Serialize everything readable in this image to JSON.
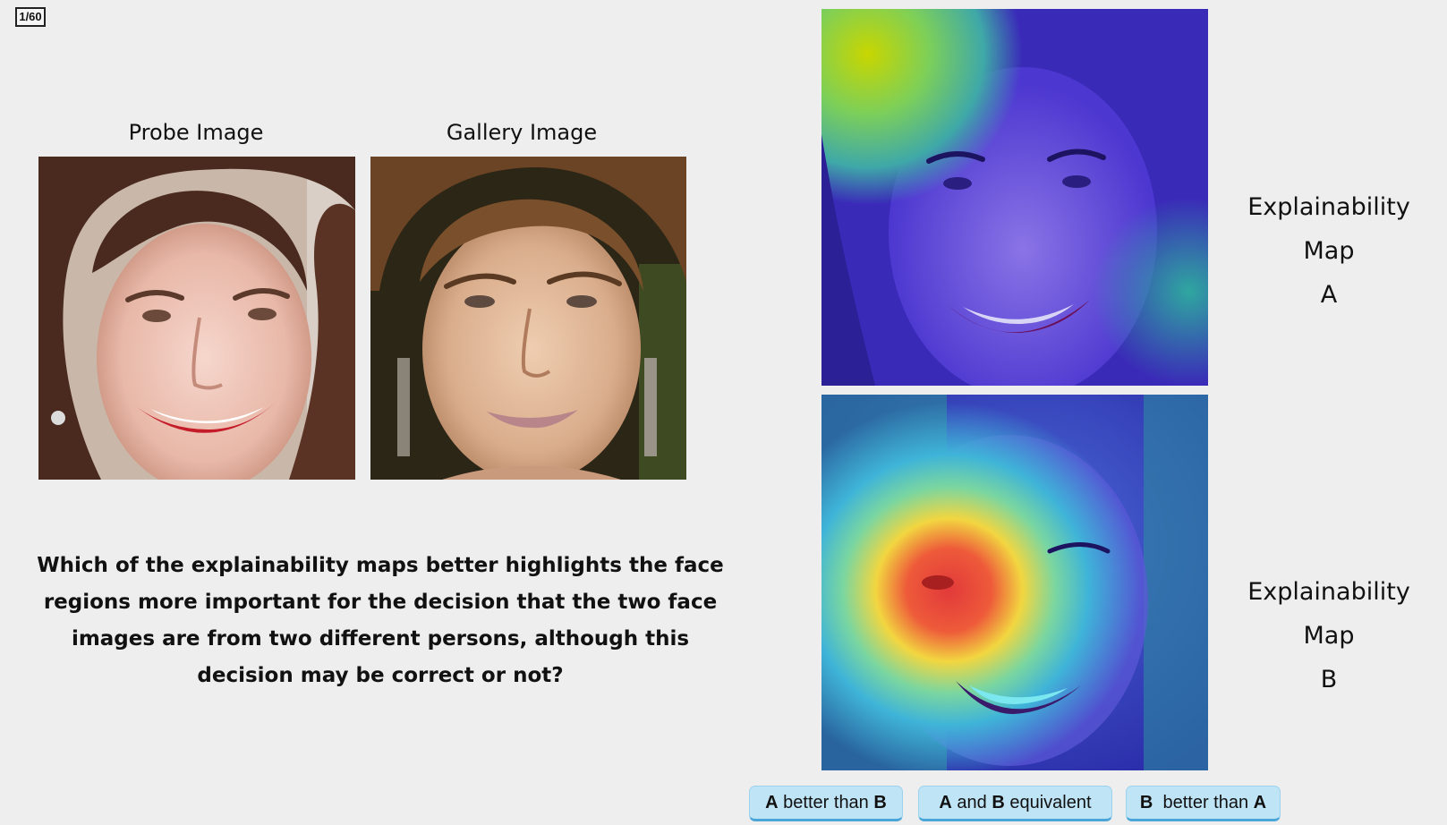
{
  "progress": {
    "counter": "1/60"
  },
  "images": {
    "probe_label": "Probe Image",
    "gallery_label": "Gallery Image"
  },
  "question": "Which of the explainability maps better highlights the face regions more important for the decision that the two face images are from two different persons, although this decision may be correct or not?",
  "maps": {
    "a_label_line1": "Explainability Map",
    "a_label_line2": "A",
    "b_label_line1": "Explainability Map",
    "b_label_line2": "B"
  },
  "choices": {
    "a_better": {
      "left": "A",
      "middle": " better than ",
      "right": "B"
    },
    "equivalent": {
      "left": "A",
      "middle": " and ",
      "right": "B",
      "tail": " equivalent"
    },
    "b_better": {
      "left": "B",
      "middle": "  better than ",
      "right": "A"
    }
  },
  "colors": {
    "background": "#eeeeee",
    "button_fill": "#bfe4f6",
    "button_border": "#4aa6d8",
    "heatmap_cool": "#3b2bd0",
    "heatmap_hot": "#e02020"
  }
}
